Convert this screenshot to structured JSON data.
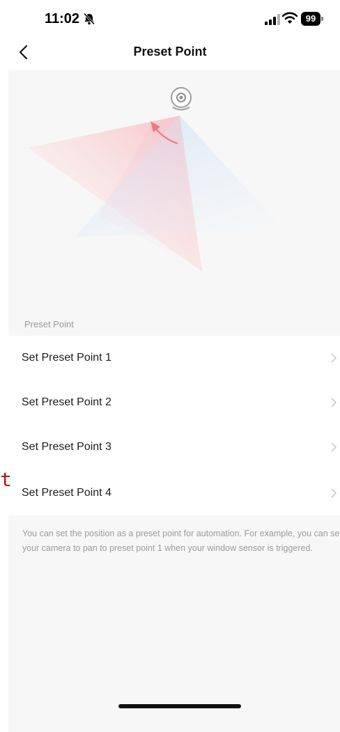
{
  "status_bar": {
    "time": "11:02",
    "battery": "99"
  },
  "nav": {
    "title": "Preset Point"
  },
  "section": {
    "label": "Preset Point"
  },
  "presets": [
    {
      "label": "Set Preset Point 1"
    },
    {
      "label": "Set Preset Point 2"
    },
    {
      "label": "Set Preset Point 3"
    },
    {
      "label": "Set Preset Point 4"
    }
  ],
  "footer": {
    "text": "You can set the position as a preset point for automation. For example, you can set your camera to pan to preset point 1 when your window sensor is triggered."
  },
  "side_glyph": "t",
  "icons": {
    "back": "chevron-left-icon",
    "camera": "camera-icon",
    "row_chevron": "chevron-right-icon",
    "silent": "bell-slash-icon",
    "signal": "signal-icon",
    "wifi": "wifi-icon"
  },
  "colors": {
    "sweep_from": "#f7c5c5",
    "sweep_to": "#cfe4f8",
    "arrow": "#f27b84",
    "muted_text": "#999999"
  }
}
